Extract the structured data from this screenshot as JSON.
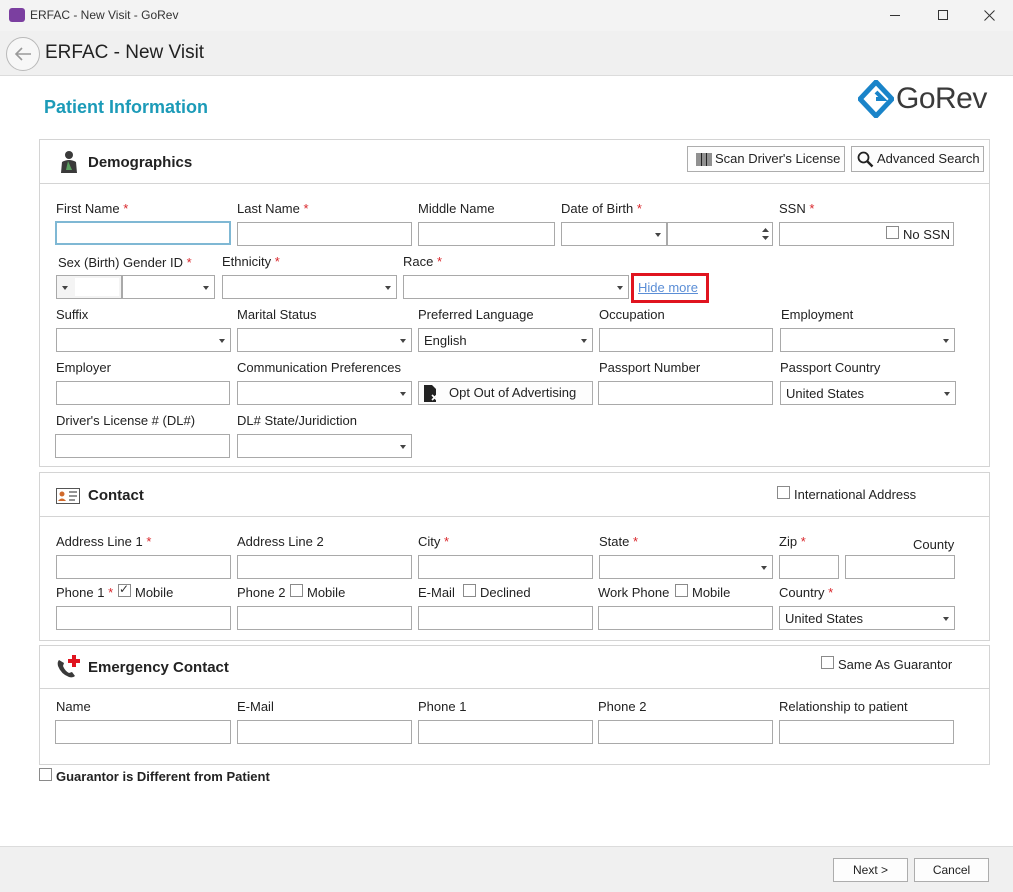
{
  "window": {
    "title": "ERFAC - New Visit - GoRev",
    "app_icon": "gorev-app-icon"
  },
  "header": {
    "title": "ERFAC - New Visit",
    "back_icon": "back-arrow-icon"
  },
  "page": {
    "heading": "Patient Information",
    "logo_text": "GoRev",
    "colors": {
      "heading": "#1c9bb8",
      "logo_blue": "#1a84c9",
      "highlight": "#e0141f",
      "link": "#5b8ed6"
    }
  },
  "demographics": {
    "title": "Demographics",
    "scan_button": "Scan Driver's License",
    "search_button": "Advanced Search",
    "first_name": "First Name",
    "last_name": "Last Name",
    "middle_name": "Middle Name",
    "dob": "Date of Birth",
    "ssn": "SSN",
    "no_ssn": "No SSN",
    "sex_gender": "Sex (Birth)  Gender ID",
    "ethnicity": "Ethnicity",
    "race": "Race",
    "hide_more": "Hide more",
    "suffix": "Suffix",
    "marital_status": "Marital Status",
    "preferred_language": "Preferred Language",
    "preferred_language_value": "English",
    "occupation": "Occupation",
    "employment": "Employment",
    "employer": "Employer",
    "communication_preferences": "Communication Preferences",
    "opt_out": "Opt Out of Advertising",
    "passport_number": "Passport Number",
    "passport_country": "Passport Country",
    "passport_country_value": "United States",
    "drivers_license": "Driver's License # (DL#)",
    "dl_state": "DL# State/Juridiction"
  },
  "contact": {
    "title": "Contact",
    "international": "International Address",
    "address1": "Address Line 1",
    "address2": "Address Line 2",
    "city": "City",
    "state": "State",
    "zip": "Zip",
    "county": "County",
    "phone1": "Phone 1",
    "mobile": "Mobile",
    "phone2": "Phone 2",
    "email": "E-Mail",
    "declined": "Declined",
    "work_phone": "Work Phone",
    "country": "Country",
    "country_value": "United States"
  },
  "emergency": {
    "title": "Emergency Contact",
    "same_as_guarantor": "Same As Guarantor",
    "name": "Name",
    "email": "E-Mail",
    "phone1": "Phone 1",
    "phone2": "Phone 2",
    "relationship": "Relationship to patient"
  },
  "guarantor": {
    "label": "Guarantor is Different from Patient"
  },
  "footer": {
    "next": "Next >",
    "cancel": "Cancel"
  }
}
